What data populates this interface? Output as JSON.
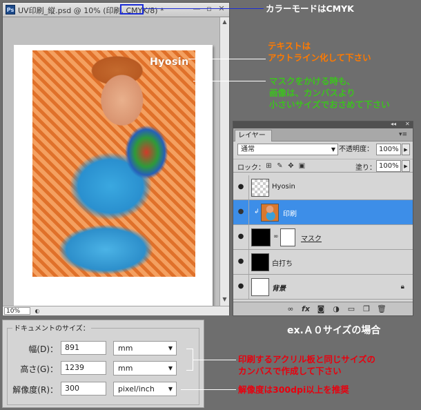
{
  "document_window": {
    "ps_icon": "Ps",
    "title": "UV印刷_縦.psd @ 10% (印刷, CMYK/8) *",
    "min_glyph": "—",
    "restore_glyph": "▫",
    "close_glyph": "✕",
    "zoom": "10%",
    "photo_text": "Hyosin"
  },
  "layers_panel": {
    "tab": "レイヤー",
    "blend_mode": "通常",
    "opacity_label": "不透明度：",
    "opacity_value": "100%",
    "lock_label": "ロック：",
    "fill_label": "塗り：",
    "fill_value": "100%",
    "layers": [
      {
        "name": "Hyosin"
      },
      {
        "name": "印刷"
      },
      {
        "name": "マスク"
      },
      {
        "name": "白打ち"
      },
      {
        "name": "背景"
      }
    ]
  },
  "document_size": {
    "legend": "ドキュメントのサイズ：",
    "width_label": "幅(D)：",
    "width_value": "891",
    "width_unit": "mm",
    "height_label": "高さ(G)：",
    "height_value": "1239",
    "height_unit": "mm",
    "resolution_label": "解像度(R)：",
    "resolution_value": "300",
    "resolution_unit": "pixel/inch"
  },
  "annotations": {
    "color_mode": "カラーモードはCMYK",
    "outline_line1": "テキストは",
    "outline_line2": "アウトライン化して下さい",
    "mask_line1": "マスクをかける時も、",
    "mask_line2": "画像は、カンバスより",
    "mask_line3": "小さいサイズでおさめて下さい",
    "example": "ex.Ａ０サイズの場合",
    "canvas_line1": "印刷するアクリル板と同じサイズの",
    "canvas_line2": "カンバスで作成して下さい",
    "resolution_note": "解像度は300dpi以上を推奨"
  },
  "colors": {
    "background": "#6e6e6e",
    "annotation_blue": "#1a2bd6",
    "annotation_orange": "#ff7a00",
    "annotation_green": "#3cc21e",
    "annotation_red": "#e8000e",
    "layer_selected": "#3d8ee8"
  }
}
